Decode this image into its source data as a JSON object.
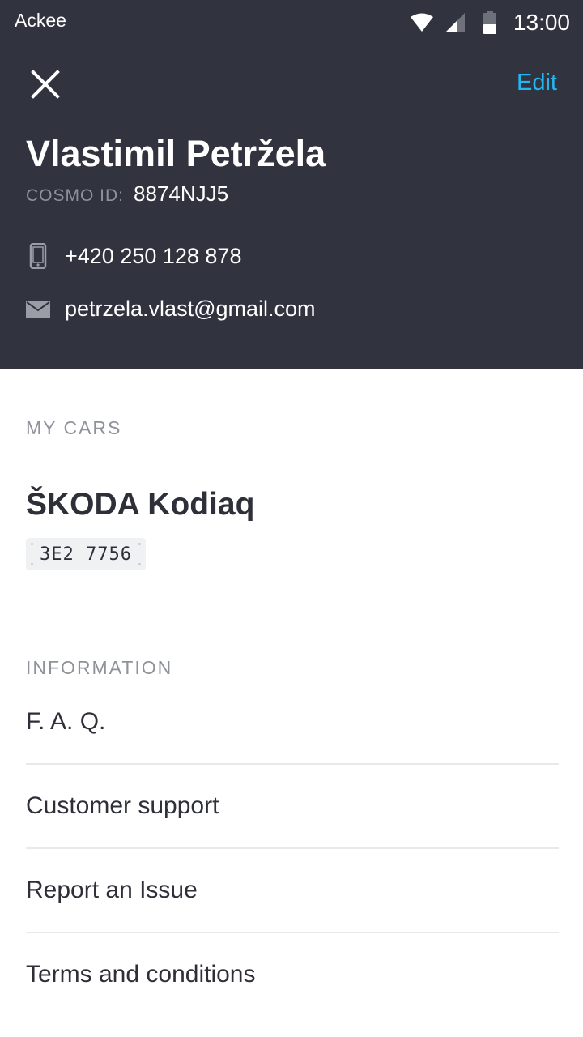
{
  "status_bar": {
    "carrier": "Ackee",
    "time": "13:00",
    "icons": [
      "wifi-icon",
      "cell-signal-icon",
      "battery-icon"
    ]
  },
  "header": {
    "close_icon": "close-icon",
    "edit_label": "Edit",
    "user_name": "Vlastimil Petržela",
    "cosmo_id_label": "COSMO ID:",
    "cosmo_id_value": "8874NJJ5",
    "phone": "+420 250 128 878",
    "phone_icon": "phone-icon",
    "email": "petrzela.vlast@gmail.com",
    "email_icon": "mail-icon"
  },
  "my_cars": {
    "section_label": "MY CARS",
    "cars": [
      {
        "name": "ŠKODA Kodiaq",
        "plate": "3E2 7756"
      }
    ]
  },
  "information": {
    "section_label": "INFORMATION",
    "items": [
      {
        "label": "F. A. Q."
      },
      {
        "label": "Customer support"
      },
      {
        "label": "Report an Issue"
      },
      {
        "label": "Terms and conditions"
      }
    ]
  },
  "colors": {
    "header_bg": "#31333e",
    "accent": "#23b6f0",
    "muted": "#8f929b",
    "text_dark": "#2e2f38"
  }
}
